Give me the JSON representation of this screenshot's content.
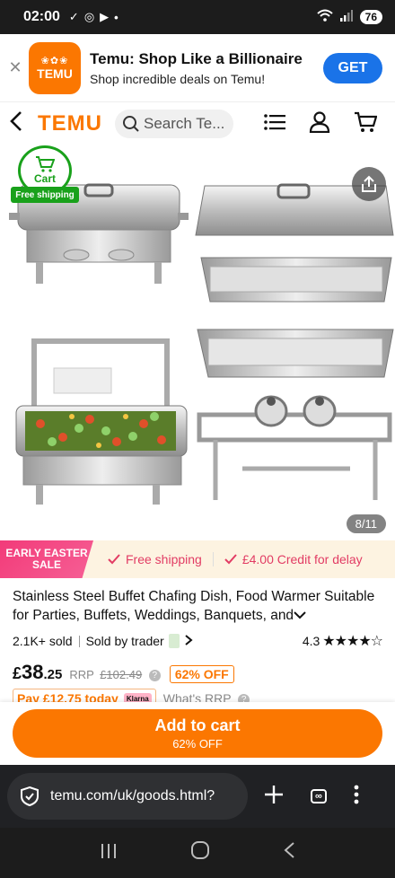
{
  "status_bar": {
    "time": "02:00",
    "battery": "76"
  },
  "app_banner": {
    "title": "Temu: Shop Like a Billionaire",
    "subtitle": "Shop incredible deals on Temu!",
    "logo_text": "TEMU",
    "get_label": "GET"
  },
  "header": {
    "logo": "TEMU",
    "search_placeholder": "Search Te..."
  },
  "gallery": {
    "cart_badge_label": "Cart",
    "free_shipping_badge": "Free shipping",
    "image_counter": "8/11"
  },
  "promo": {
    "badge": "EARLY EASTER SALE",
    "free_shipping": "Free shipping",
    "credit": "£4.00 Credit for delay"
  },
  "product": {
    "title": "Stainless Steel Buffet Chafing Dish, Food Warmer Suitable for Parties, Buffets, Weddings, Banquets, and",
    "sold": "2.1K+ sold",
    "seller": "Sold by trader",
    "rating": "4.3",
    "stars": "★★★★☆",
    "price_currency": "£",
    "price_main": "38",
    "price_decimal": ".25",
    "rrp_label": "RRP",
    "rrp_value": "£102.49",
    "discount": "62% OFF",
    "pay_later": "Pay £12.75 today",
    "klarna": "Klarna",
    "whats_rrp": "What's RRP"
  },
  "cta": {
    "label": "Add to cart",
    "sub": "62% OFF"
  },
  "browser": {
    "url": "temu.com/uk/goods.html?",
    "tab_count": "∞"
  },
  "colors": {
    "brand_orange": "#fb7701",
    "free_ship_green": "#19a11b",
    "promo_pink": "#e23c64",
    "banner_blue": "#1a73e8"
  }
}
